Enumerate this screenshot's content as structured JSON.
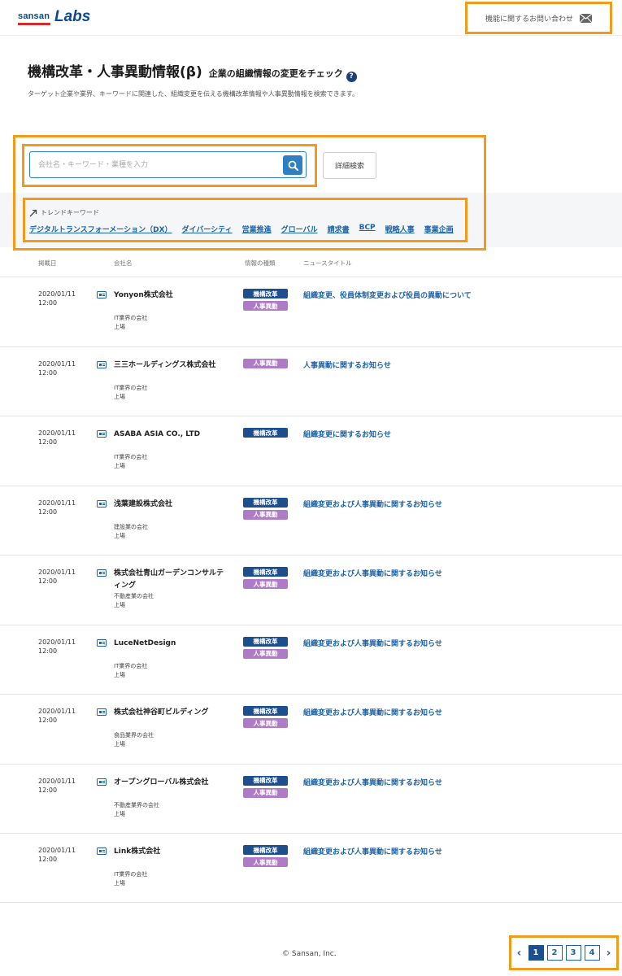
{
  "header": {
    "logo_brand": "sansan",
    "logo_product": "Labs",
    "contact_label": "機能に関するお問い合わせ"
  },
  "page": {
    "title": "機構改革・人事異動情報(β)",
    "subtitle": "企業の組織情報の変更をチェック",
    "help_symbol": "?",
    "description": "ターゲット企業や業界、キーワードに関連した、組織変更を伝える機構改革情報や人事異動情報を検索できます。"
  },
  "search": {
    "placeholder": "会社名・キーワード・業種を入力",
    "value": "",
    "detail_button": "詳細検索"
  },
  "trend": {
    "label": "トレンドキーワード",
    "keywords": [
      "デジタルトランスフォーメーション（DX）",
      "ダイバーシティ",
      "営業推進",
      "グローバル",
      "請求書",
      "BCP",
      "戦略人事",
      "事業企画"
    ]
  },
  "table": {
    "headers": [
      "掲載日",
      "会社名",
      "情報の種類",
      "ニュースタイトル"
    ],
    "badge_labels": {
      "kikou": "機構改革",
      "jinji": "人事異動"
    },
    "rows": [
      {
        "date": "2020/01/11",
        "time": "12:00",
        "company": "Yonyon株式会社",
        "industry": "IT業界の会社",
        "listing": "上場",
        "badges": [
          "kikou",
          "jinji"
        ],
        "news": "組織変更、役員体制変更および役員の異動について"
      },
      {
        "date": "2020/01/11",
        "time": "12:00",
        "company": "三三ホールディングス株式会社",
        "industry": "IT業界の会社",
        "listing": "上場",
        "badges": [
          "jinji"
        ],
        "news": "人事異動に関するお知らせ"
      },
      {
        "date": "2020/01/11",
        "time": "12:00",
        "company": "ASABA ASIA CO., LTD",
        "industry": "IT業界の会社",
        "listing": "上場",
        "badges": [
          "kikou"
        ],
        "news": "組織変更に関するお知らせ"
      },
      {
        "date": "2020/01/11",
        "time": "12:00",
        "company": "浅葉建設株式会社",
        "industry": "建設業の会社",
        "listing": "上場",
        "badges": [
          "kikou",
          "jinji"
        ],
        "news": "組織変更および人事異動に関するお知らせ"
      },
      {
        "date": "2020/01/11",
        "time": "12:00",
        "company": "株式会社青山ガーデンコンサルティング",
        "industry": "不動産業の会社",
        "listing": "上場",
        "badges": [
          "kikou",
          "jinji"
        ],
        "news": "組織変更および人事異動に関するお知らせ"
      },
      {
        "date": "2020/01/11",
        "time": "12:00",
        "company": "LuceNetDesign",
        "industry": "IT業界の会社",
        "listing": "上場",
        "badges": [
          "kikou",
          "jinji"
        ],
        "news": "組織変更および人事異動に関するお知らせ"
      },
      {
        "date": "2020/01/11",
        "time": "12:00",
        "company": "株式会社神谷町ビルディング",
        "industry": "食品業界の会社",
        "listing": "上場",
        "badges": [
          "kikou",
          "jinji"
        ],
        "news": "組織変更および人事異動に関するお知らせ"
      },
      {
        "date": "2020/01/11",
        "time": "12:00",
        "company": "オープングローバル株式会社",
        "industry": "不動産業界の会社",
        "listing": "上場",
        "badges": [
          "kikou",
          "jinji"
        ],
        "news": "組織変更および人事異動に関するお知らせ"
      },
      {
        "date": "2020/01/11",
        "time": "12:00",
        "company": "Link株式会社",
        "industry": "IT業界の会社",
        "listing": "上場",
        "badges": [
          "kikou",
          "jinji"
        ],
        "news": "組織変更および人事異動に関するお知らせ"
      }
    ]
  },
  "pagination": {
    "prev": "‹",
    "next": "›",
    "pages": [
      "1",
      "2",
      "3",
      "4"
    ],
    "current": "1"
  },
  "footer": {
    "copyright": "© Sansan, Inc."
  },
  "colors": {
    "brand": "#0d4a8f",
    "accent_red": "#d62b2b",
    "link": "#1e63a8",
    "highlight": "#f29a1c",
    "badge_kikou": "#1d4f8c",
    "badge_jinji": "#b07bc6"
  }
}
